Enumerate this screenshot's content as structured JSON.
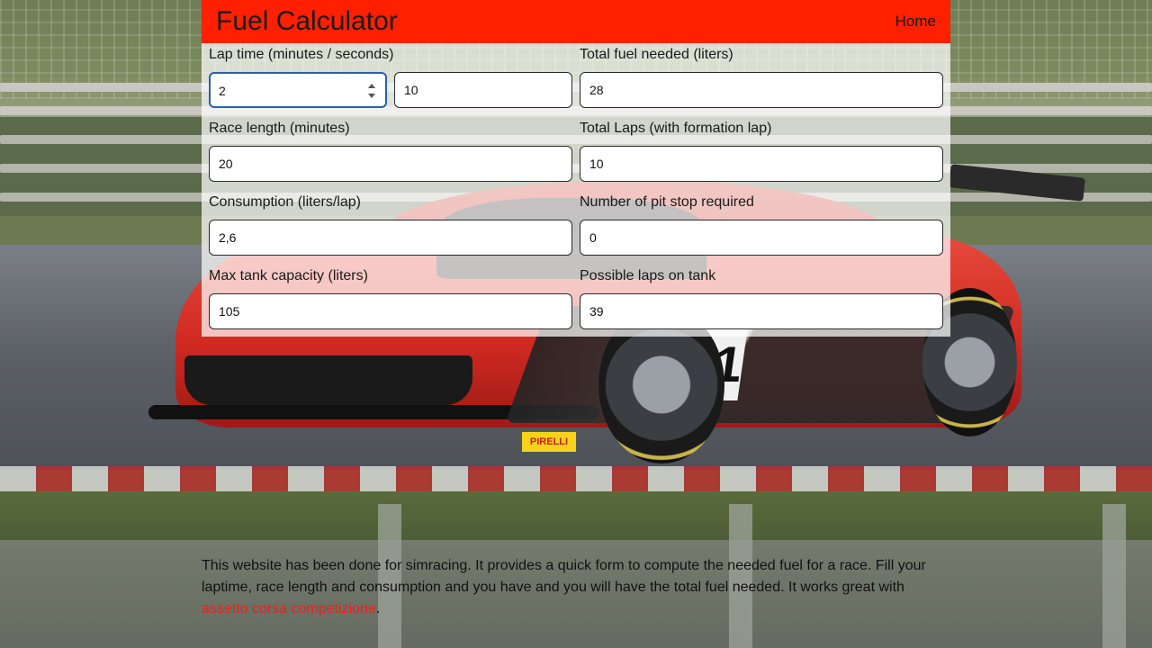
{
  "navbar": {
    "title": "Fuel Calculator",
    "home_label": "Home"
  },
  "form": {
    "lap_time": {
      "label": "Lap time (minutes / seconds)",
      "minutes": "2",
      "seconds": "10"
    },
    "race_length": {
      "label": "Race length (minutes)",
      "value": "20"
    },
    "consumption": {
      "label": "Consumption (liters/lap)",
      "value": "2,6"
    },
    "max_tank": {
      "label": "Max tank capacity (liters)",
      "value": "105"
    },
    "total_fuel": {
      "label": "Total fuel needed (liters)",
      "value": "28"
    },
    "total_laps": {
      "label": "Total Laps (with formation lap)",
      "value": "10"
    },
    "pit_stops": {
      "label": "Number of pit stop required",
      "value": "0"
    },
    "possible_laps": {
      "label": "Possible laps on tank",
      "value": "39"
    }
  },
  "description": {
    "text": "This website has been done for simracing. It provides a quick form to compute the needed fuel for a race. Fill your laptime, race length and consumption and you have and you will have the total fuel needed. It works great with ",
    "link_label": "assetto corsa competizione",
    "trailing": "."
  },
  "car": {
    "number": "11",
    "sponsor": "PIRELLI"
  },
  "colors": {
    "navbar": "#ff2000",
    "link": "#e8221b",
    "focus_border": "#2a5fb0"
  }
}
